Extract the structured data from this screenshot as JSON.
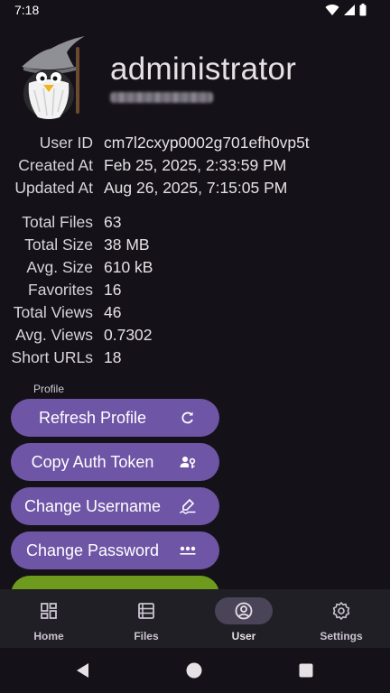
{
  "status_bar": {
    "time": "7:18"
  },
  "profile": {
    "username": "administrator"
  },
  "info": [
    {
      "label": "User ID",
      "value": "cm7l2cxyp0002g701efh0vp5t"
    },
    {
      "label": "Created At",
      "value": "Feb 25, 2025, 2:33:59 PM"
    },
    {
      "label": "Updated At",
      "value": "Aug 26, 2025, 7:15:05 PM"
    }
  ],
  "stats": [
    {
      "label": "Total Files",
      "value": "63"
    },
    {
      "label": "Total Size",
      "value": "38 MB"
    },
    {
      "label": "Avg. Size",
      "value": "610 kB"
    },
    {
      "label": "Favorites",
      "value": "16"
    },
    {
      "label": "Total Views",
      "value": "46"
    },
    {
      "label": "Avg. Views",
      "value": "0.7302"
    },
    {
      "label": "Short URLs",
      "value": "18"
    }
  ],
  "section_label": "Profile",
  "buttons": [
    {
      "label": "Refresh Profile",
      "icon": "refresh-icon"
    },
    {
      "label": "Copy Auth Token",
      "icon": "key-user-icon"
    },
    {
      "label": "Change Username",
      "icon": "signature-icon"
    },
    {
      "label": "Change Password",
      "icon": "password-dots-icon"
    }
  ],
  "bottom_nav": [
    {
      "label": "Home",
      "icon": "dashboard-icon",
      "active": false
    },
    {
      "label": "Files",
      "icon": "list-icon",
      "active": false
    },
    {
      "label": "User",
      "icon": "account-circle-icon",
      "active": true
    },
    {
      "label": "Settings",
      "icon": "gear-icon",
      "active": false
    }
  ],
  "colors": {
    "background": "#141218",
    "button": "#6f55a6",
    "button_green": "#6e9a1e",
    "nav_bar": "#211f26",
    "nav_active_pill": "#4a4458"
  }
}
